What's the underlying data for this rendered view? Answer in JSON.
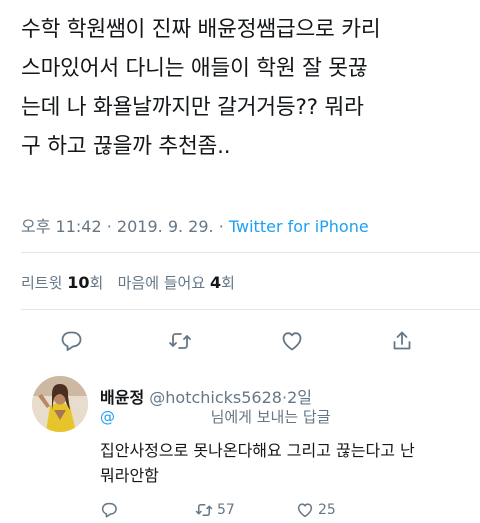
{
  "tweet": {
    "text": "수학 학원쌤이 진짜 배윤정쌤급으로 카리\n스마있어서 다니는 애들이 학원 잘 못끊\n는데 나 화욜날까지만 갈거거등?? 뭐라\n구 하고 끊을까 추천좀..",
    "time": "오후 11:42",
    "separator1": "·",
    "date": "2019. 9. 29.",
    "separator2": "·",
    "source": "Twitter for iPhone"
  },
  "stats": {
    "retweets_label": "리트윗",
    "retweets_count": "10",
    "retweets_unit": "회",
    "likes_label": "마음에 들어요",
    "likes_count": "4",
    "likes_unit": "회"
  },
  "actions": [
    {
      "icon": "reply-icon"
    },
    {
      "icon": "retweet-icon"
    },
    {
      "icon": "like-icon"
    },
    {
      "icon": "share-icon"
    }
  ],
  "reply": {
    "name": "배윤정",
    "handle": "@hotchicks5628",
    "separator": "·",
    "age": "2일",
    "to_at": "@",
    "to_suffix": "님에게 보내는 답글",
    "text": "집안사정으로 못나온다해요  그리고 끊는다고 난\n뭐라안함",
    "retweet_count": "57",
    "like_count": "25"
  },
  "colors": {
    "link": "#1da1f2",
    "muted": "#657786",
    "text": "#14171a",
    "divider": "#e1e8ed"
  }
}
